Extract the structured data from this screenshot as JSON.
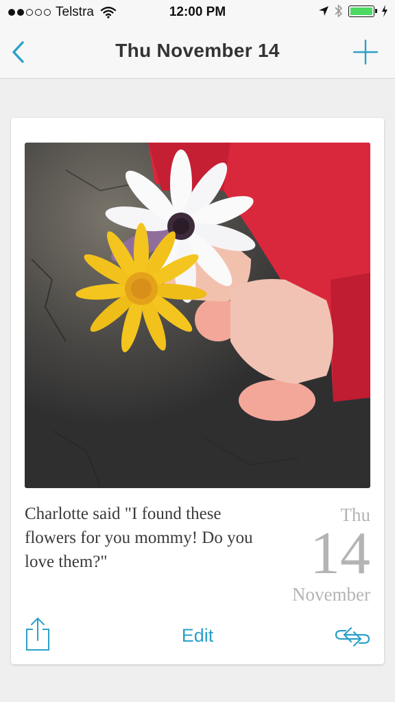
{
  "status_bar": {
    "carrier": "Telstra",
    "time": "12:00 PM",
    "signal_strength": 2,
    "signal_total": 5,
    "battery_level": 1.0,
    "icons": [
      "wifi-icon",
      "location-icon",
      "bluetooth-icon",
      "battery-icon",
      "charging-icon"
    ]
  },
  "nav": {
    "title": "Thu November 14",
    "back_icon": "chevron-left-icon",
    "add_icon": "plus-icon"
  },
  "entry": {
    "photo_alt": "child-holding-flowers-photo",
    "caption": "Charlotte said \"I found these flowers for you mommy! Do you love them?\"",
    "date": {
      "day_of_week": "Thu",
      "day": "14",
      "month": "November"
    }
  },
  "toolbar": {
    "edit_label": "Edit",
    "share_icon": "share-icon",
    "swap_icon": "swap-icon"
  },
  "colors": {
    "accent": "#2aa0c8",
    "date_text": "#b4b4b4",
    "background": "#efefef"
  }
}
